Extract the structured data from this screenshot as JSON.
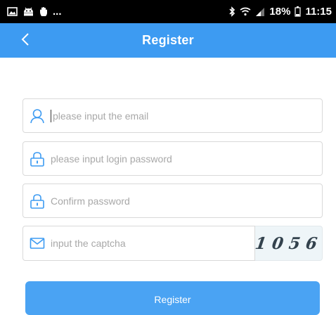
{
  "status_bar": {
    "left_icons": [
      "image-icon",
      "android-icon",
      "hand-icon"
    ],
    "overflow": "...",
    "right_icons": [
      "bluetooth-icon",
      "wifi-icon",
      "signal-icon"
    ],
    "battery_percent": "18%",
    "time": "11:15"
  },
  "nav": {
    "back_icon": "chevron-left-icon",
    "title": "Register"
  },
  "form": {
    "email": {
      "icon": "user-icon",
      "placeholder": "please input the email",
      "value": ""
    },
    "password": {
      "icon": "lock-icon",
      "placeholder": "please input login password",
      "value": ""
    },
    "confirm": {
      "icon": "lock-icon",
      "placeholder": "Confirm password",
      "value": ""
    },
    "captcha": {
      "icon": "mail-icon",
      "placeholder": "input the captcha",
      "value": "",
      "image_text": "1056"
    },
    "submit_label": "Register"
  },
  "colors": {
    "nav_background": "#3d9bf2",
    "button_background": "#4aa3f3",
    "icon_accent": "#3d9bf2",
    "status_bar": "#000000"
  }
}
